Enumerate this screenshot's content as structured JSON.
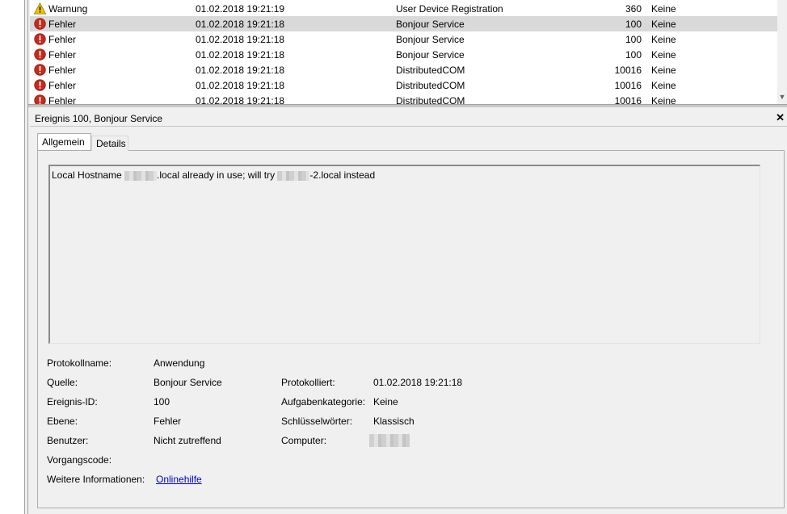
{
  "event_list": {
    "rows": [
      {
        "level": "Warnung",
        "icon": "warning-icon",
        "date": "01.02.2018 19:21:19",
        "source": "User Device Registration",
        "event_id": "360",
        "task": "Keine"
      },
      {
        "level": "Fehler",
        "icon": "error-icon",
        "date": "01.02.2018 19:21:18",
        "source": "Bonjour Service",
        "event_id": "100",
        "task": "Keine",
        "selected": true
      },
      {
        "level": "Fehler",
        "icon": "error-icon",
        "date": "01.02.2018 19:21:18",
        "source": "Bonjour Service",
        "event_id": "100",
        "task": "Keine"
      },
      {
        "level": "Fehler",
        "icon": "error-icon",
        "date": "01.02.2018 19:21:18",
        "source": "Bonjour Service",
        "event_id": "100",
        "task": "Keine"
      },
      {
        "level": "Fehler",
        "icon": "error-icon",
        "date": "01.02.2018 19:21:18",
        "source": "DistributedCOM",
        "event_id": "10016",
        "task": "Keine"
      },
      {
        "level": "Fehler",
        "icon": "error-icon",
        "date": "01.02.2018 19:21:18",
        "source": "DistributedCOM",
        "event_id": "10016",
        "task": "Keine"
      },
      {
        "level": "Fehler",
        "icon": "error-icon",
        "date": "01.02.2018 19:21:18",
        "source": "DistributedCOM",
        "event_id": "10016",
        "task": "Keine"
      }
    ]
  },
  "details": {
    "title": "Ereignis 100, Bonjour Service",
    "close_label": "✕",
    "tabs": [
      {
        "label": "Allgemein",
        "active": true
      },
      {
        "label": "Details",
        "active": false
      }
    ],
    "message": {
      "part1": "Local Hostname ",
      "part2": ".local already in use; will try ",
      "part3": "-2.local instead"
    },
    "properties": {
      "log_name_label": "Protokollname:",
      "log_name_value": "Anwendung",
      "source_label": "Quelle:",
      "source_value": "Bonjour Service",
      "logged_label": "Protokolliert:",
      "logged_value": "01.02.2018 19:21:18",
      "event_id_label": "Ereignis-ID:",
      "event_id_value": "100",
      "task_category_label": "Aufgabenkategorie:",
      "task_category_value": "Keine",
      "level_label": "Ebene:",
      "level_value": "Fehler",
      "keywords_label": "Schlüsselwörter:",
      "keywords_value": "Klassisch",
      "user_label": "Benutzer:",
      "user_value": "Nicht zutreffend",
      "computer_label": "Computer:",
      "opcode_label": "Vorgangscode:",
      "more_info_label": "Weitere Informationen:",
      "more_info_link": "Onlinehilfe"
    }
  }
}
